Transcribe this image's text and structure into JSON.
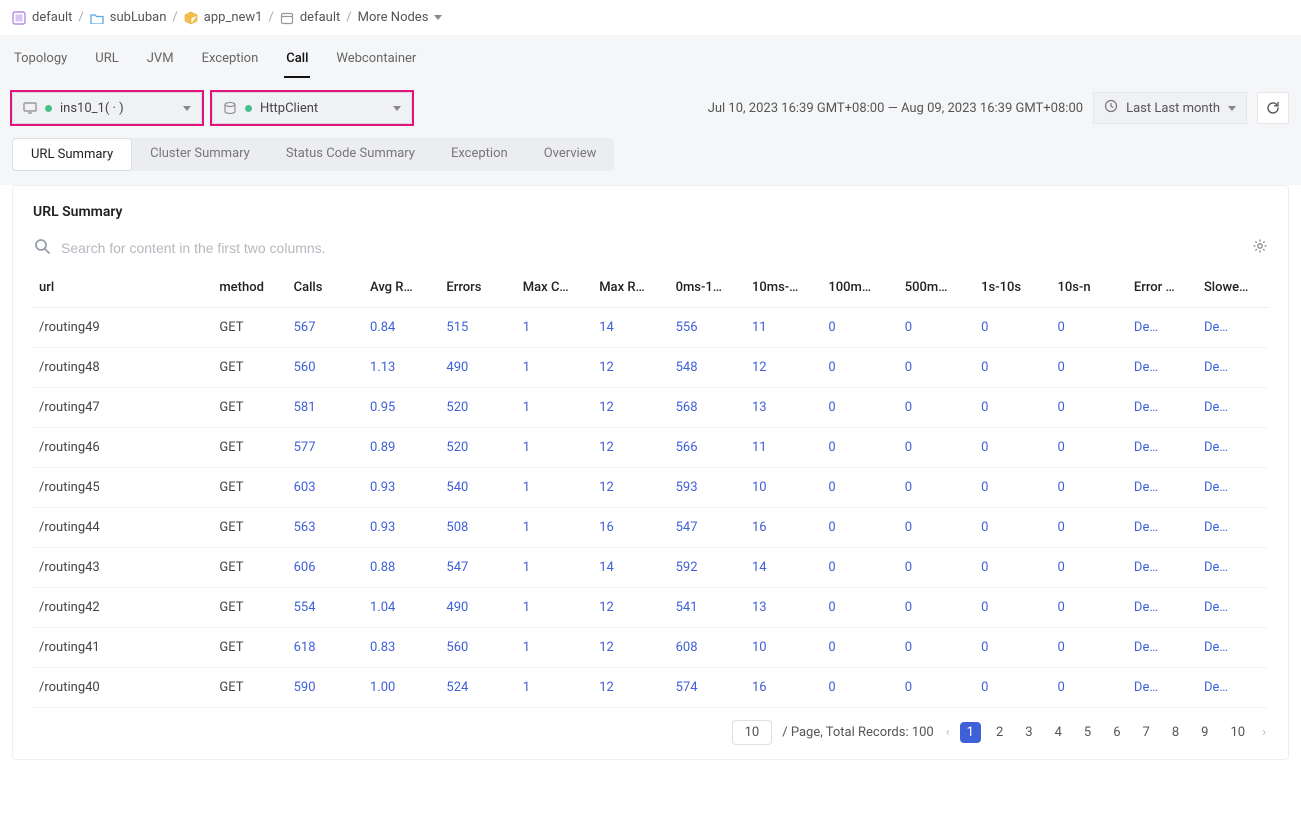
{
  "breadcrumb": {
    "items": [
      {
        "icon": "app",
        "label": "default"
      },
      {
        "icon": "folder",
        "label": "subLuban"
      },
      {
        "icon": "cube",
        "label": "app_new1"
      },
      {
        "icon": "cal",
        "label": "default"
      }
    ],
    "more": "More Nodes"
  },
  "tabs": [
    "Topology",
    "URL",
    "JVM",
    "Exception",
    "Call",
    "Webcontainer"
  ],
  "active_tab": "Call",
  "selectors": {
    "instance": "ins10_1( ·                          )",
    "target": "HttpClient"
  },
  "daterange": "Jul 10, 2023 16:39 GMT+08:00 — Aug 09, 2023 16:39 GMT+08:00",
  "preset": "Last Last month",
  "subtabs": [
    "URL Summary",
    "Cluster Summary",
    "Status Code Summary",
    "Exception",
    "Overview"
  ],
  "active_subtab": "URL Summary",
  "panel_title": "URL Summary",
  "search_placeholder": "Search for content in the first two columns.",
  "columns": [
    "url",
    "method",
    "Calls",
    "Avg R…",
    "Errors",
    "Max C…",
    "Max R…",
    "0ms-1…",
    "10ms-…",
    "100m…",
    "500m…",
    "1s-10s",
    "10s-n",
    "Error …",
    "Slowe…"
  ],
  "link_text": "De…",
  "rows": [
    {
      "url": "/routing49",
      "method": "GET",
      "v": [
        "567",
        "0.84",
        "515",
        "1",
        "14",
        "556",
        "11",
        "0",
        "0",
        "0",
        "0"
      ]
    },
    {
      "url": "/routing48",
      "method": "GET",
      "v": [
        "560",
        "1.13",
        "490",
        "1",
        "12",
        "548",
        "12",
        "0",
        "0",
        "0",
        "0"
      ]
    },
    {
      "url": "/routing47",
      "method": "GET",
      "v": [
        "581",
        "0.95",
        "520",
        "1",
        "12",
        "568",
        "13",
        "0",
        "0",
        "0",
        "0"
      ]
    },
    {
      "url": "/routing46",
      "method": "GET",
      "v": [
        "577",
        "0.89",
        "520",
        "1",
        "12",
        "566",
        "11",
        "0",
        "0",
        "0",
        "0"
      ]
    },
    {
      "url": "/routing45",
      "method": "GET",
      "v": [
        "603",
        "0.93",
        "540",
        "1",
        "12",
        "593",
        "10",
        "0",
        "0",
        "0",
        "0"
      ]
    },
    {
      "url": "/routing44",
      "method": "GET",
      "v": [
        "563",
        "0.93",
        "508",
        "1",
        "16",
        "547",
        "16",
        "0",
        "0",
        "0",
        "0"
      ]
    },
    {
      "url": "/routing43",
      "method": "GET",
      "v": [
        "606",
        "0.88",
        "547",
        "1",
        "14",
        "592",
        "14",
        "0",
        "0",
        "0",
        "0"
      ]
    },
    {
      "url": "/routing42",
      "method": "GET",
      "v": [
        "554",
        "1.04",
        "490",
        "1",
        "12",
        "541",
        "13",
        "0",
        "0",
        "0",
        "0"
      ]
    },
    {
      "url": "/routing41",
      "method": "GET",
      "v": [
        "618",
        "0.83",
        "560",
        "1",
        "12",
        "608",
        "10",
        "0",
        "0",
        "0",
        "0"
      ]
    },
    {
      "url": "/routing40",
      "method": "GET",
      "v": [
        "590",
        "1.00",
        "524",
        "1",
        "12",
        "574",
        "16",
        "0",
        "0",
        "0",
        "0"
      ]
    }
  ],
  "pager": {
    "pagesize": "10",
    "label": "/ Page,  Total Records: 100",
    "pages": [
      "1",
      "2",
      "3",
      "4",
      "5",
      "6",
      "7",
      "8",
      "9",
      "10"
    ],
    "active": "1"
  }
}
